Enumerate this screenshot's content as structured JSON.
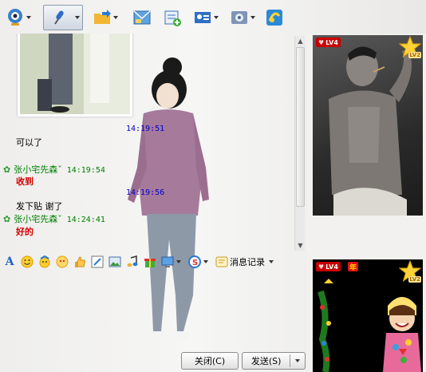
{
  "toolbar": {
    "items": [
      {
        "icon": "webcam-icon"
      },
      {
        "icon": "microphone-icon"
      },
      {
        "icon": "folder-send-icon"
      },
      {
        "icon": "image-mail-icon"
      },
      {
        "icon": "add-note-icon"
      },
      {
        "icon": "contact-card-icon"
      },
      {
        "icon": "settings-icon"
      },
      {
        "icon": "app-icon"
      }
    ]
  },
  "chat": {
    "photo_timestamp": "14:19:51",
    "messages": [
      {
        "text": "可以了"
      },
      {
        "sender": "张小宅先森ˇ",
        "time": "14:19:54",
        "text": "收到"
      },
      {
        "timestamp": "14:19:56"
      },
      {
        "text": "发下贴   谢了"
      },
      {
        "sender": "张小宅先森ˇ",
        "time": "14:24:41",
        "text": "好的"
      }
    ]
  },
  "format_bar": {
    "icons": [
      "font-icon",
      "smiley-icon",
      "magic-face-icon",
      "emoji-icon",
      "thumbs-up-icon",
      "edit-pen-icon",
      "picture-icon",
      "music-icon",
      "gift-icon",
      "screenshot-icon",
      "sogou-icon"
    ],
    "history_label": "消息记录"
  },
  "buttons": {
    "close_label": "关闭(C)",
    "send_label": "发送(S)"
  },
  "right_panel": {
    "top_show": {
      "level": "LV4",
      "star_level": "LV2"
    },
    "bottom_show": {
      "level": "LV4",
      "year_tag": "年",
      "star_level": "LV2"
    }
  },
  "colors": {
    "timestamp_blue": "#0000cc",
    "sender_green": "#008000",
    "message_red": "#d20000"
  }
}
